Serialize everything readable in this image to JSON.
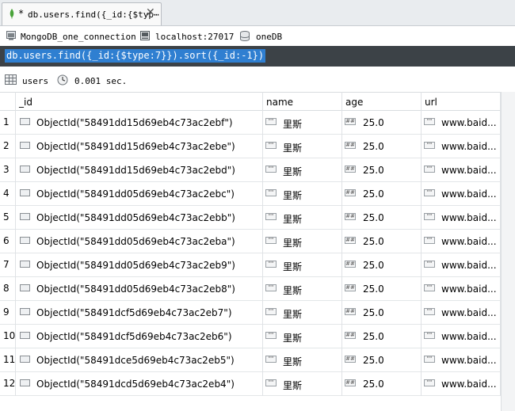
{
  "tab": {
    "dirty_marker": "*",
    "title": "db.users.find({_id:{$typ⋯",
    "close": "✕"
  },
  "connection": {
    "name": "MongoDB_one_connection",
    "host": "localhost:27017",
    "database": "oneDB"
  },
  "query": {
    "text": "db.users.find({_id:{$type:7}}).sort({_id:-1})"
  },
  "info": {
    "collection": "users",
    "time": "0.001 sec."
  },
  "columns": [
    "_id",
    "name",
    "age",
    "url"
  ],
  "type_icons": {
    "string": "\"\"",
    "number": "##"
  },
  "rows": [
    {
      "n": "1",
      "id": "ObjectId(\"58491dd15d69eb4c73ac2ebf\")",
      "name": "里斯",
      "age": "25.0",
      "url": "www.baid..."
    },
    {
      "n": "2",
      "id": "ObjectId(\"58491dd15d69eb4c73ac2ebe\")",
      "name": "里斯",
      "age": "25.0",
      "url": "www.baid..."
    },
    {
      "n": "3",
      "id": "ObjectId(\"58491dd15d69eb4c73ac2ebd\")",
      "name": "里斯",
      "age": "25.0",
      "url": "www.baid..."
    },
    {
      "n": "4",
      "id": "ObjectId(\"58491dd05d69eb4c73ac2ebc\")",
      "name": "里斯",
      "age": "25.0",
      "url": "www.baid..."
    },
    {
      "n": "5",
      "id": "ObjectId(\"58491dd05d69eb4c73ac2ebb\")",
      "name": "里斯",
      "age": "25.0",
      "url": "www.baid..."
    },
    {
      "n": "6",
      "id": "ObjectId(\"58491dd05d69eb4c73ac2eba\")",
      "name": "里斯",
      "age": "25.0",
      "url": "www.baid..."
    },
    {
      "n": "7",
      "id": "ObjectId(\"58491dd05d69eb4c73ac2eb9\")",
      "name": "里斯",
      "age": "25.0",
      "url": "www.baid..."
    },
    {
      "n": "8",
      "id": "ObjectId(\"58491dd05d69eb4c73ac2eb8\")",
      "name": "里斯",
      "age": "25.0",
      "url": "www.baid..."
    },
    {
      "n": "9",
      "id": "ObjectId(\"58491dcf5d69eb4c73ac2eb7\")",
      "name": "里斯",
      "age": "25.0",
      "url": "www.baid..."
    },
    {
      "n": "10",
      "id": "ObjectId(\"58491dcf5d69eb4c73ac2eb6\")",
      "name": "里斯",
      "age": "25.0",
      "url": "www.baid..."
    },
    {
      "n": "11",
      "id": "ObjectId(\"58491dce5d69eb4c73ac2eb5\")",
      "name": "里斯",
      "age": "25.0",
      "url": "www.baid..."
    },
    {
      "n": "12",
      "id": "ObjectId(\"58491dcd5d69eb4c73ac2eb4\")",
      "name": "里斯",
      "age": "25.0",
      "url": "www.baid..."
    }
  ]
}
